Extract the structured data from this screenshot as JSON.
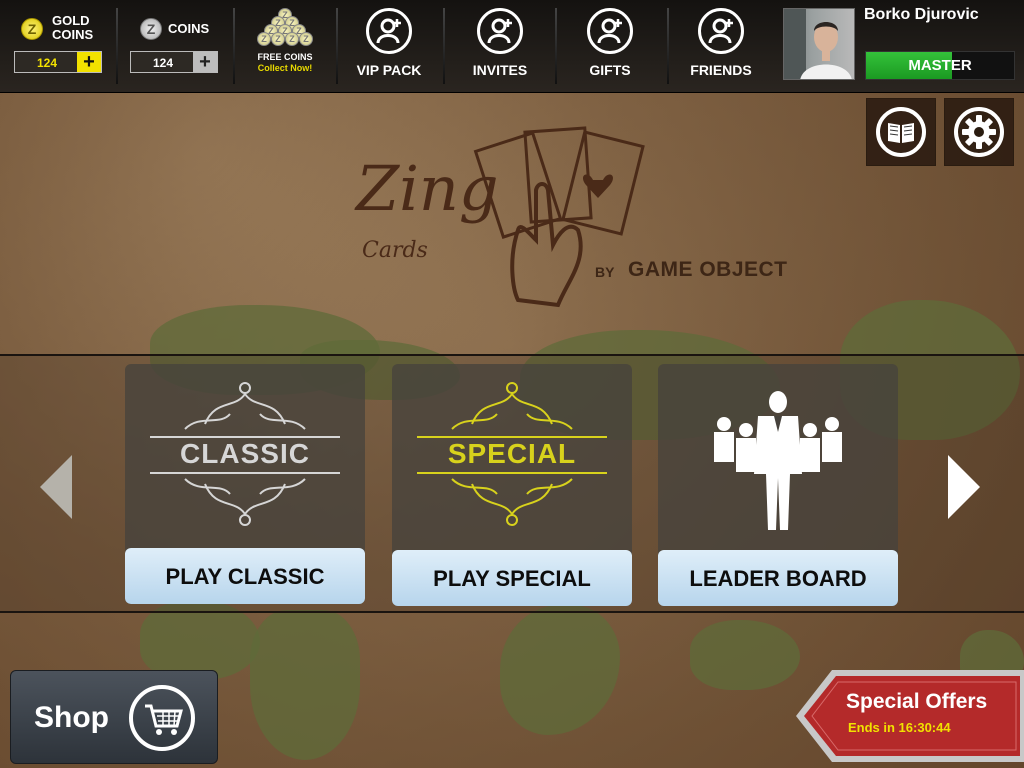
{
  "topbar": {
    "gold": {
      "coin_letter": "Z",
      "label_line1": "GOLD",
      "label_line2": "COINS",
      "count": "124",
      "plus": "+"
    },
    "silver": {
      "coin_letter": "Z",
      "label": "COINS",
      "count": "124",
      "plus": "+"
    },
    "free_coins": {
      "label": "FREE COINS",
      "sublabel": "Collect Now!",
      "coin_letter": "Z"
    },
    "nav": [
      {
        "label": "VIP PACK",
        "icon": "add-user-icon"
      },
      {
        "label": "INVITES",
        "icon": "add-user-icon"
      },
      {
        "label": "GIFTS",
        "icon": "add-user-icon"
      },
      {
        "label": "FRIENDS",
        "icon": "add-user-icon"
      }
    ],
    "user": {
      "name": "Borko Djurovic",
      "level": "MASTER",
      "level_progress": 0.58
    }
  },
  "utility": {
    "rules_icon": "book-icon",
    "settings_icon": "gear-icon"
  },
  "logo": {
    "title": "Zing",
    "subtitle": "Cards",
    "by": "BY",
    "company": "GAME OBJECT"
  },
  "modes": [
    {
      "emblem": "CLASSIC",
      "button": "PLAY CLASSIC"
    },
    {
      "emblem": "SPECIAL",
      "button": "PLAY SPECIAL"
    },
    {
      "emblem": "",
      "button": "LEADER BOARD"
    }
  ],
  "bottom": {
    "shop_label": "Shop",
    "offers_title": "Special Offers",
    "offers_timer": "Ends in 16:30:44"
  },
  "colors": {
    "gold_accent": "#f2e100",
    "level_green": "#22a82a",
    "special_yellow": "#d8d21c",
    "offer_red": "#b42a2a",
    "card_button": "#cfe3f3"
  }
}
